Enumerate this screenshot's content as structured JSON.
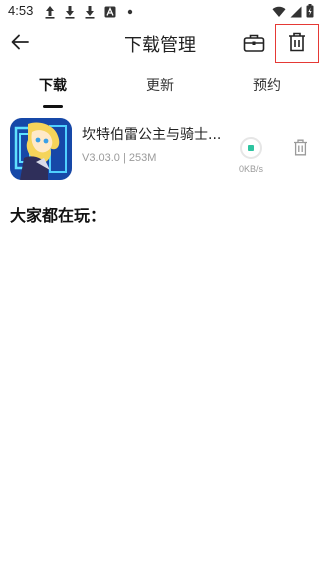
{
  "status_bar": {
    "time": "4:53",
    "icons": [
      "upload-icon",
      "download-icon",
      "download-icon",
      "font-icon",
      "dot-icon",
      "wifi-icon",
      "signal-icon",
      "battery-icon"
    ]
  },
  "header": {
    "title": "下载管理"
  },
  "tabs": [
    {
      "label": "下载",
      "active": true
    },
    {
      "label": "更新",
      "active": false
    },
    {
      "label": "预约",
      "active": false
    }
  ],
  "downloads": [
    {
      "name": "坎特伯雷公主与骑士...",
      "version": "V3.03.0",
      "size": "253M",
      "meta": "V3.03.0 | 253M",
      "speed": "0KB/s",
      "progress": 0
    }
  ],
  "section": {
    "title": "大家都在玩："
  },
  "colors": {
    "accent": "#2ec4a0",
    "highlight_border": "#e53935",
    "secondary_text": "#9a9a9a"
  }
}
